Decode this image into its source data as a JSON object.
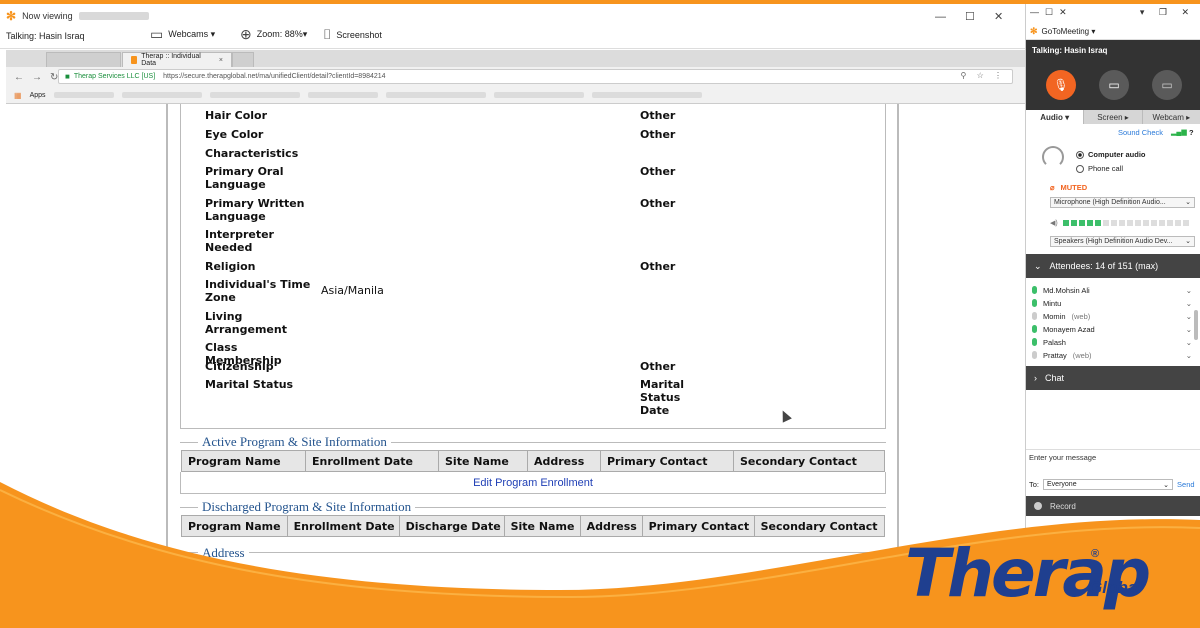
{
  "viewer": {
    "now_viewing": "Now viewing",
    "talking": "Talking: Hasin Israq",
    "webcams_label": "Webcams ▾",
    "zoom_label": "Zoom: 88%▾",
    "screenshot_label": "Screenshot",
    "window_controls": "—  ☐  ✕"
  },
  "browser": {
    "tab_active_title": "Therap :: Individual Data",
    "secure_label": "Therap Services LLC [US]",
    "url": "https://secure.therapglobal.net/ma/unifiedClient/detail?clientId=8984214",
    "apps_label": "Apps"
  },
  "fields": [
    {
      "label": "Hair Color",
      "value": "",
      "right_label": "Other"
    },
    {
      "label": "Eye Color",
      "value": "",
      "right_label": "Other"
    },
    {
      "label": "Characteristics",
      "value": "",
      "right_label": ""
    },
    {
      "label": "Primary Oral Language",
      "value": "",
      "right_label": "Other"
    },
    {
      "label": "Primary Written Language",
      "value": "",
      "right_label": "Other"
    },
    {
      "label": "Interpreter Needed",
      "value": "",
      "right_label": ""
    },
    {
      "label": "Religion",
      "value": "",
      "right_label": "Other"
    },
    {
      "label": "Individual's Time Zone",
      "value": "Asia/Manila",
      "right_label": ""
    },
    {
      "label": "Living Arrangement",
      "value": "",
      "right_label": ""
    },
    {
      "label": "Class Membership",
      "value": "",
      "right_label": ""
    },
    {
      "label": "Citizenship",
      "value": "",
      "right_label": "Other"
    },
    {
      "label": "Marital Status",
      "value": "",
      "right_label": "Marital Status Date"
    }
  ],
  "active_program": {
    "title": "Active Program & Site Information",
    "headers": [
      "Program Name",
      "Enrollment Date",
      "Site Name",
      "Address",
      "Primary Contact",
      "Secondary Contact"
    ],
    "edit_link": "Edit Program Enrollment"
  },
  "discharged_program": {
    "title": "Discharged Program & Site Information",
    "headers": [
      "Program Name",
      "Enrollment Date",
      "Discharge Date",
      "Site Name",
      "Address",
      "Primary Contact",
      "Secondary Contact"
    ]
  },
  "address_section": {
    "title": "Address"
  },
  "gotomeeting": {
    "app_name": "GoToMeeting ▾",
    "talking": "Talking: Hasin Israq",
    "tabs": [
      "Audio ▾",
      "Screen ▸",
      "Webcam ▸"
    ],
    "sound_check": "Sound Check",
    "computer_audio": "Computer audio",
    "phone_call": "Phone call",
    "muted": "MUTED",
    "microphone": "Microphone (High Definition Audio...",
    "speakers": "Speakers (High Definition Audio Dev...",
    "mic_level": 0.31,
    "attendees_header": "Attendees:  14 of 151 (max)",
    "attendees": [
      {
        "name": "Md.Mohsin Ali",
        "tag": "",
        "mic": true
      },
      {
        "name": "Mintu",
        "tag": "",
        "mic": true
      },
      {
        "name": "Momin",
        "tag": "(web)",
        "mic": false
      },
      {
        "name": "Monayem Azad",
        "tag": "",
        "mic": true
      },
      {
        "name": "Palash",
        "tag": "",
        "mic": true
      },
      {
        "name": "Prattay",
        "tag": "(web)",
        "mic": false
      }
    ],
    "chat_header": "Chat",
    "chat_placeholder": "Enter your message",
    "to_label": "To:",
    "to_value": "Everyone",
    "send_label": "Send",
    "record_label": "Record"
  },
  "brand": {
    "logo_word": "Therap",
    "logo_sub": "Global",
    "logo_reg": "®",
    "orange": "#f7941d",
    "blue": "#1f3f8f"
  }
}
